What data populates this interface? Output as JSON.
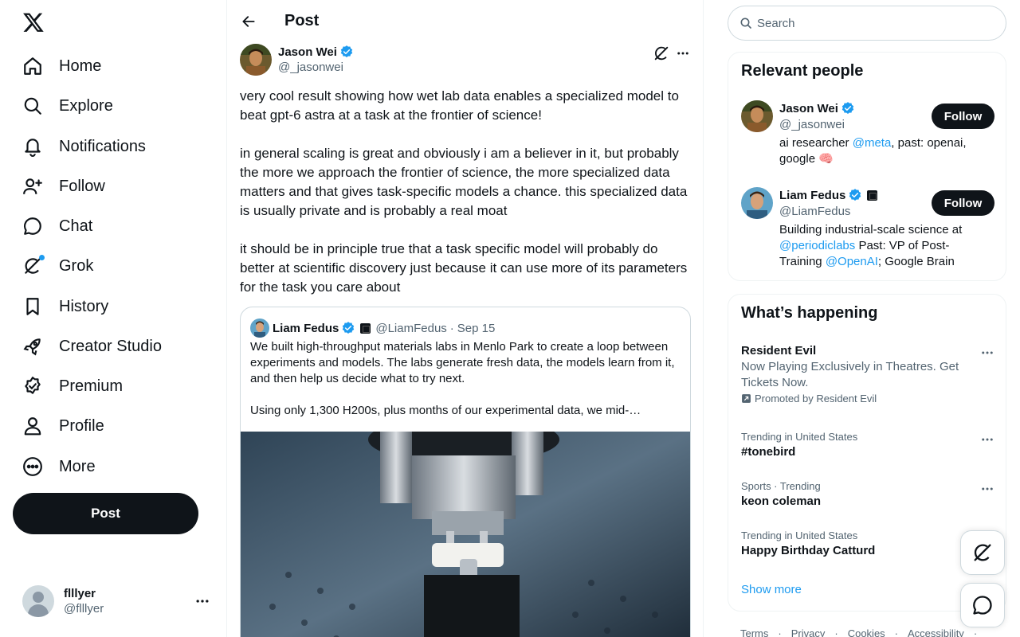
{
  "nav": {
    "items": [
      {
        "label": "Home",
        "icon": "home-icon"
      },
      {
        "label": "Explore",
        "icon": "search-icon"
      },
      {
        "label": "Notifications",
        "icon": "bell-icon"
      },
      {
        "label": "Follow",
        "icon": "person-add-icon"
      },
      {
        "label": "Chat",
        "icon": "chat-icon"
      },
      {
        "label": "Grok",
        "icon": "grok-icon"
      },
      {
        "label": "History",
        "icon": "bookmark-icon"
      },
      {
        "label": "Creator Studio",
        "icon": "rocket-icon"
      },
      {
        "label": "Premium",
        "icon": "verified-badge-icon"
      },
      {
        "label": "Profile",
        "icon": "profile-icon"
      },
      {
        "label": "More",
        "icon": "more-circle-icon"
      }
    ],
    "post_button": "Post",
    "account": {
      "name": "flllyer",
      "handle": "@flllyer"
    }
  },
  "main": {
    "header_title": "Post",
    "post": {
      "author_name": "Jason Wei",
      "author_handle": "@_jasonwei",
      "paragraphs": [
        "very cool result showing how wet lab data enables a specialized model to beat gpt-6 astra at a task at the frontier of science!",
        "in general scaling is great and obviously i am a believer in it, but probably the more we approach the frontier of science, the more specialized data matters and that gives task-specific models a chance. this specialized data is usually private and is probably a real moat",
        "it should be in principle true that a task specific model will probably do better at scientific discovery just because it can use more of its parameters for the task you care about"
      ],
      "quote": {
        "author_name": "Liam Fedus",
        "author_handle": "@LiamFedus",
        "separator": "·",
        "date": "Sep 15",
        "paragraphs": [
          "We built high-throughput materials labs in Menlo Park to create a loop between experiments and models. The labs generate fresh data, the models learn from it, and then help us decide what to try next.",
          "Using only 1,300 H200s, plus months of our experimental data, we mid-…"
        ]
      }
    }
  },
  "sidebar": {
    "search_placeholder": "Search",
    "relevant_people": {
      "title": "Relevant people",
      "people": [
        {
          "name": "Jason Wei",
          "handle": "@_jasonwei",
          "follow_label": "Follow",
          "bio": {
            "t1": "ai researcher ",
            "l1": "@meta",
            "t2": ", past: openai, google 🧠"
          }
        },
        {
          "name": "Liam Fedus",
          "handle": "@LiamFedus",
          "follow_label": "Follow",
          "bio": {
            "t1": "Building industrial-scale science at ",
            "l1": "@periodiclabs",
            "t2": " Past: VP of Post-Training ",
            "l2": "@OpenAI",
            "t3": "; Google Brain"
          }
        }
      ]
    },
    "happening": {
      "title": "What’s happening",
      "promo": {
        "title": "Resident Evil",
        "description": "Now Playing Exclusively in Theatres. Get Tickets Now.",
        "promoted_by": "Promoted by Resident Evil"
      },
      "trends": [
        {
          "context": "Trending in United States",
          "name": "#tonebird"
        },
        {
          "context": "Sports · Trending",
          "name": "keon coleman"
        },
        {
          "context": "Trending in United States",
          "name": "Happy Birthday Catturd"
        }
      ],
      "show_more": "Show more"
    },
    "footer": [
      "Terms",
      "Privacy",
      "Cookies",
      "Accessibility"
    ]
  },
  "colors": {
    "accent": "#1d9bf0",
    "text": "#0f1419",
    "secondary": "#536471",
    "border": "#eff3f4"
  }
}
